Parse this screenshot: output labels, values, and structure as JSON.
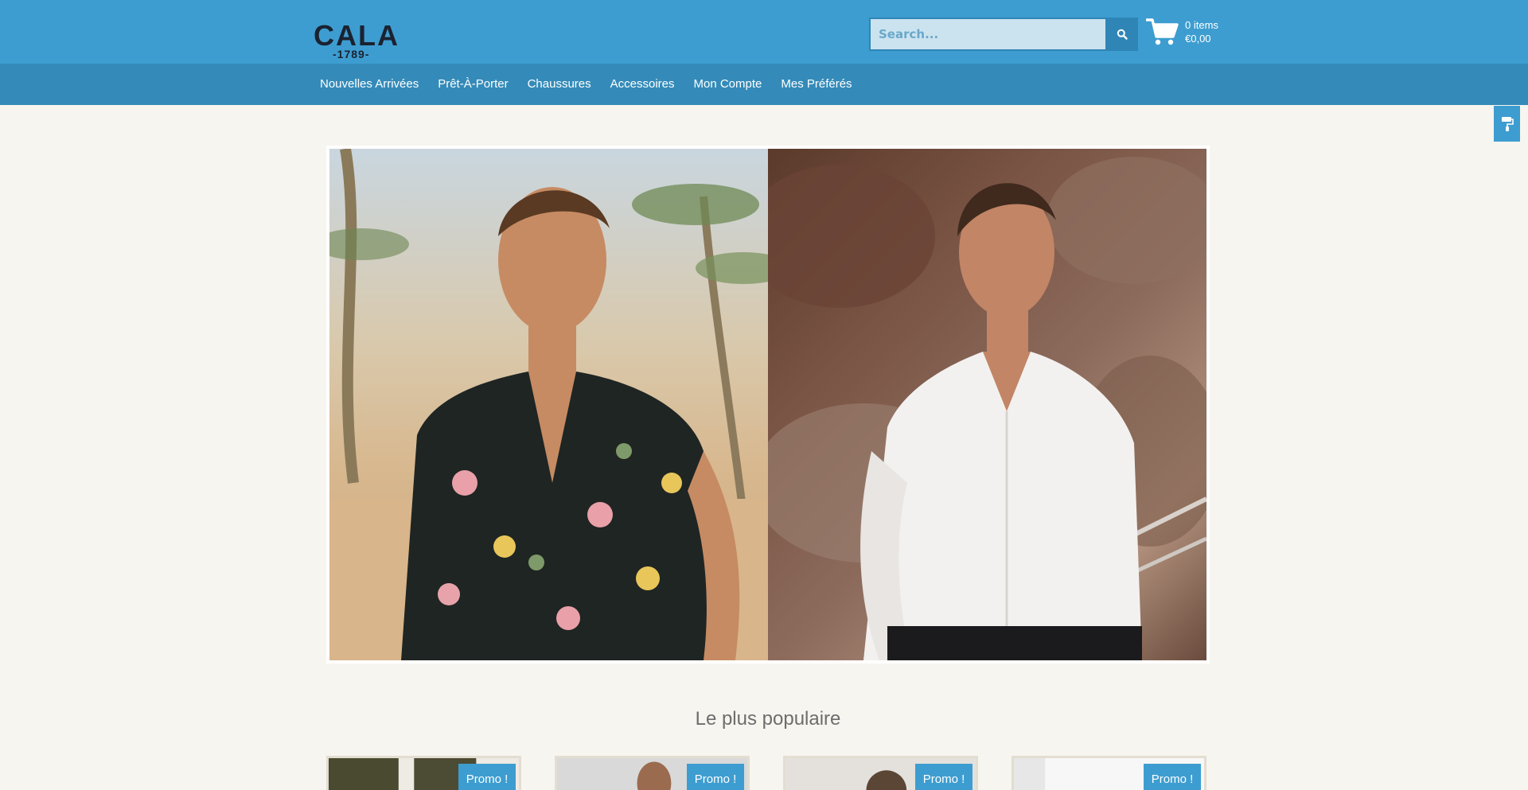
{
  "header": {
    "logo_main": "CALA",
    "logo_sub": "-1789-",
    "search": {
      "placeholder": "Search..."
    },
    "cart": {
      "items": "0 items",
      "price": "€0,00"
    }
  },
  "nav": {
    "items": [
      {
        "label": "Nouvelles Arrivées"
      },
      {
        "label": "Prêt-À-Porter"
      },
      {
        "label": "Chaussures"
      },
      {
        "label": "Accessoires"
      },
      {
        "label": "Mon Compte"
      },
      {
        "label": "Mes Préférés"
      }
    ]
  },
  "popular": {
    "title": "Le plus populaire",
    "products": [
      {
        "badge": "Promo !"
      },
      {
        "badge": "Promo !"
      },
      {
        "badge": "Promo !"
      },
      {
        "badge": "Promo !"
      }
    ]
  },
  "colors": {
    "header": "#3d9dd0",
    "nav": "#348bb9",
    "accent": "#2f86b6",
    "background": "#f6f5ef"
  },
  "icons": {
    "search": "search-icon",
    "cart": "shopping-cart-icon",
    "side_tab": "paint-roller-icon"
  }
}
